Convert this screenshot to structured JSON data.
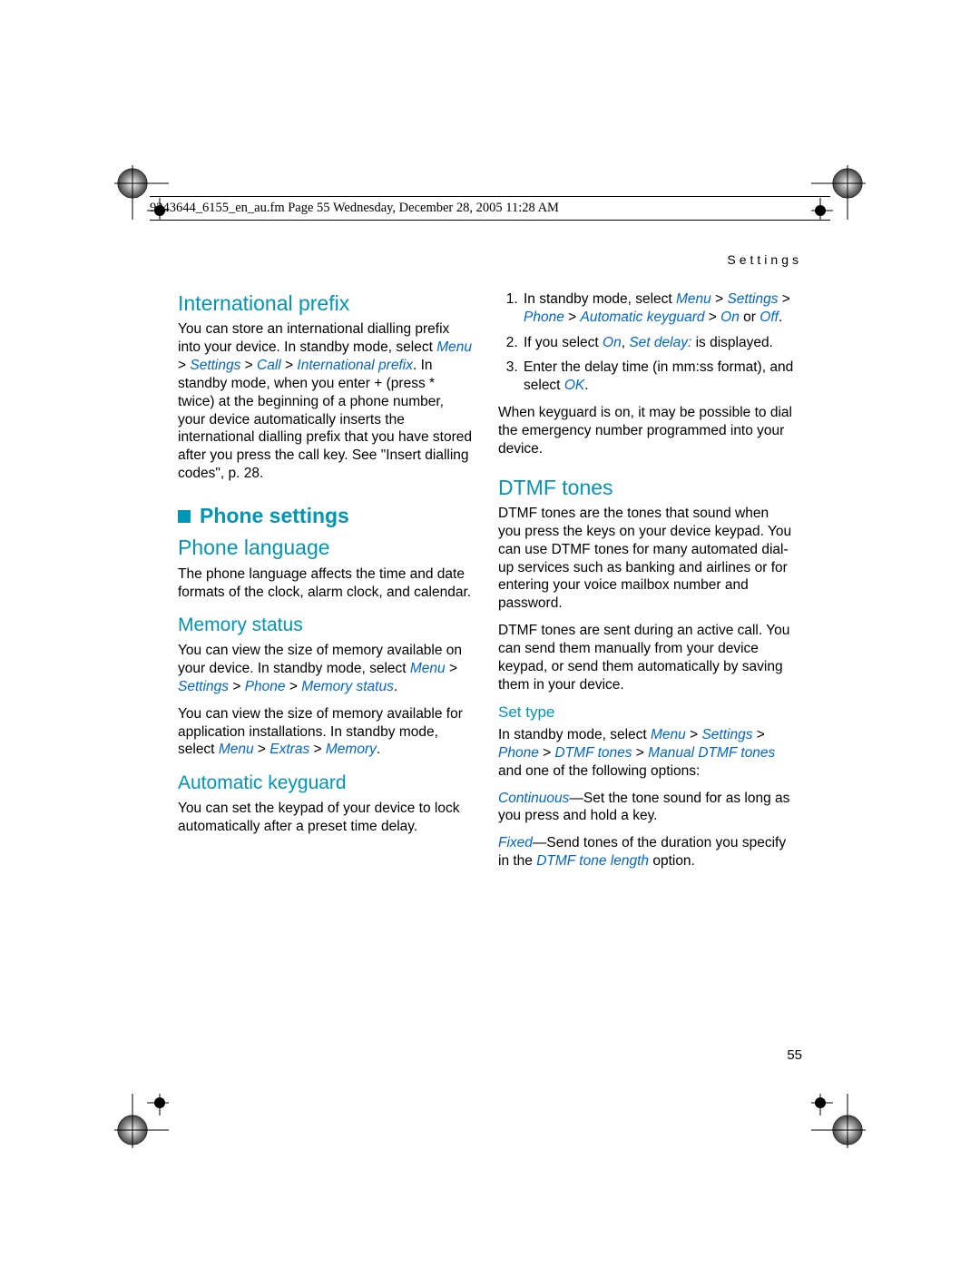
{
  "printHeader": "9243644_6155_en_au.fm  Page 55  Wednesday, December 28, 2005  11:28 AM",
  "runningHeader": "Settings",
  "pageNumber": "55",
  "col1": {
    "h1": "International prefix",
    "p1a": "You can store an international dialling prefix into your device. In standby mode, select ",
    "p1b": "Menu",
    "p1c": " > ",
    "p1d": "Settings",
    "p1e": " > ",
    "p1f": "Call",
    "p1g": " > ",
    "p1h": "International prefix",
    "p1i": ". In standby mode, when you enter + (press * twice) at the beginning of a phone number, your device automatically inserts the international dialling prefix that you have stored after you press the call key. See \"Insert dialling codes\", p. 28.",
    "sectionTitle": "Phone settings",
    "h2": "Phone language",
    "p2": "The phone language affects the time and date formats of the clock, alarm clock, and calendar.",
    "h3": "Memory status",
    "p3a": "You can view the size of memory available on your device. In standby mode, select ",
    "p3b": "Menu",
    "p3c": " > ",
    "p3d": "Settings",
    "p3e": " > ",
    "p3f": "Phone",
    "p3g": " > ",
    "p3h": "Memory status",
    "p3i": ".",
    "p4a": "You can view the size of memory available for application installations. In standby mode, select ",
    "p4b": "Menu",
    "p4c": " > ",
    "p4d": "Extras",
    "p4e": " > ",
    "p4f": "Memory",
    "p4g": ".",
    "h4": "Automatic keyguard",
    "p5": "You can set the keypad of your device to lock automatically after a preset time delay."
  },
  "col2": {
    "li1a": "In standby mode, select ",
    "li1b": "Menu",
    "li1c": " > ",
    "li1d": "Settings",
    "li1e": " > ",
    "li1f": "Phone",
    "li1g": " > ",
    "li1h": "Automatic keyguard",
    "li1i": " > ",
    "li1j": "On",
    "li1k": " or ",
    "li1l": "Off",
    "li1m": ".",
    "li2a": "If you select ",
    "li2b": "On",
    "li2c": ", ",
    "li2d": "Set delay:",
    "li2e": " is displayed.",
    "li3a": "Enter the delay time (in mm:ss format), and select ",
    "li3b": "OK",
    "li3c": ".",
    "p6": "When keyguard is on, it may be possible to dial the emergency number programmed into your device.",
    "h5": "DTMF tones",
    "p7": "DTMF tones are the tones that sound when you press the keys on your device keypad. You can use DTMF tones for many automated dial-up services such as banking and airlines or for entering your voice mailbox number and password.",
    "p8": "DTMF tones are sent during an active call. You can send them manually from your device keypad, or send them automatically by saving them in your device.",
    "h6": "Set type",
    "p9a": "In standby mode, select ",
    "p9b": "Menu",
    "p9c": " > ",
    "p9d": "Settings",
    "p9e": " > ",
    "p9f": "Phone",
    "p9g": " > ",
    "p9h": "DTMF tones",
    "p9i": " > ",
    "p9j": "Manual DTMF tones",
    "p9k": " and one of the following options:",
    "p10a": "Continuous",
    "p10b": "—Set the tone sound for as long as you press and hold a key.",
    "p11a": "Fixed",
    "p11b": "—Send tones of the duration you specify in the ",
    "p11c": "DTMF tone length",
    "p11d": " option."
  }
}
